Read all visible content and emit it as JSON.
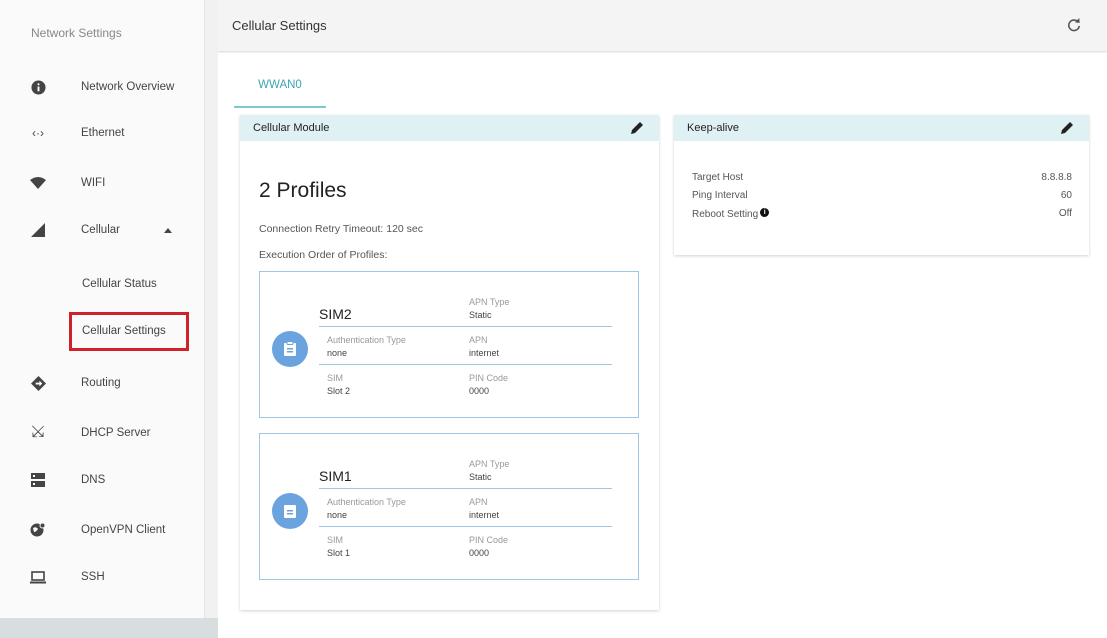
{
  "sidebar": {
    "title": "Network Settings",
    "items": [
      {
        "label": "Network Overview",
        "icon": "info-icon"
      },
      {
        "label": "Ethernet",
        "icon": "ethernet-icon"
      },
      {
        "label": "WIFI",
        "icon": "wifi-icon"
      },
      {
        "label": "Cellular",
        "icon": "cellular-signal-icon",
        "expanded": true
      },
      {
        "label": "Cellular Status",
        "sub": true
      },
      {
        "label": "Cellular Settings",
        "sub": true,
        "selected": true
      },
      {
        "label": "Routing",
        "icon": "routing-icon"
      },
      {
        "label": "DHCP Server",
        "icon": "dhcp-icon"
      },
      {
        "label": "DNS",
        "icon": "dns-icon"
      },
      {
        "label": "OpenVPN Client",
        "icon": "vpn-icon"
      },
      {
        "label": "SSH",
        "icon": "ssh-icon"
      }
    ]
  },
  "header": {
    "title": "Cellular Settings",
    "refresh_icon": "refresh-icon"
  },
  "tabs": [
    {
      "label": "WWAN0",
      "active": true
    }
  ],
  "module": {
    "title": "Cellular Module",
    "profiles_count": "2 Profiles",
    "retry_timeout": "Connection Retry Timeout: 120 sec",
    "execution_order": "Execution Order of Profiles:",
    "profiles": [
      {
        "name": "SIM2",
        "apn_type_label": "APN Type",
        "apn_type": "Static",
        "auth_type_label": "Authentication Type",
        "auth_type": "none",
        "apn_label": "APN",
        "apn": "internet",
        "sim_label": "SIM",
        "sim": "Slot 2",
        "pin_label": "PIN Code",
        "pin": "0000"
      },
      {
        "name": "SIM1",
        "apn_type_label": "APN Type",
        "apn_type": "Static",
        "auth_type_label": "Authentication Type",
        "auth_type": "none",
        "apn_label": "APN",
        "apn": "internet",
        "sim_label": "SIM",
        "sim": "Slot 1",
        "pin_label": "PIN Code",
        "pin": "0000"
      }
    ]
  },
  "keepalive": {
    "title": "Keep-alive",
    "rows": [
      {
        "label": "Target Host",
        "value": "8.8.8.8"
      },
      {
        "label": "Ping Interval",
        "value": "60"
      },
      {
        "label": "Reboot Setting",
        "value": "Off",
        "info_icon": "info-icon"
      }
    ]
  },
  "colors": {
    "accent": "#3aa6b3",
    "card_header": "#dff1f3",
    "highlight": "#d0202a",
    "profile_icon": "#6aa3dd"
  }
}
